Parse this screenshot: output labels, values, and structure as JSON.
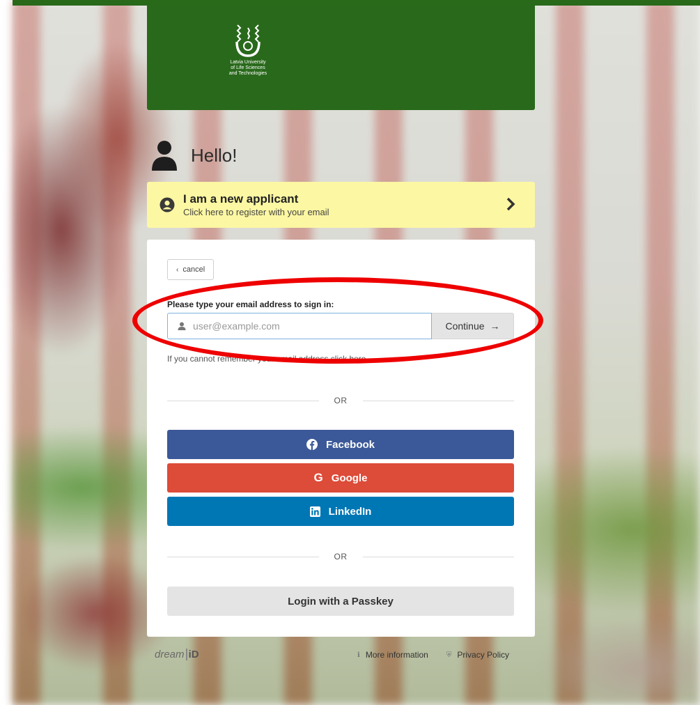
{
  "header": {
    "logo_lines": [
      "Latvia University",
      "of Life Sciences",
      "and Technologies"
    ]
  },
  "greeting": {
    "title": "Hello!"
  },
  "new_applicant": {
    "title": "I am a new applicant",
    "subtitle": "Click here to register with your email"
  },
  "signin": {
    "cancel_label": "cancel",
    "prompt": "Please type your email address to sign in:",
    "email_value": "",
    "email_placeholder": "user@example.com",
    "continue_label": "Continue",
    "forgot_text": "If you cannot remember your email address click here"
  },
  "dividers": {
    "or_label": "OR"
  },
  "social_buttons": [
    {
      "label": "Facebook",
      "color": "#3b5998"
    },
    {
      "label": "Google",
      "color": "#dd4b39"
    },
    {
      "label": "LinkedIn",
      "color": "#0077b5"
    }
  ],
  "passkey": {
    "label": "Login with a Passkey"
  },
  "footer": {
    "brand_text": "dream",
    "brand_id": "iD",
    "more_info_label": "More information",
    "privacy_label": "Privacy Policy"
  },
  "colors": {
    "header_green": "#29691b",
    "applicant_yellow": "#fcf7a2",
    "highlight_red": "#ee0000"
  }
}
